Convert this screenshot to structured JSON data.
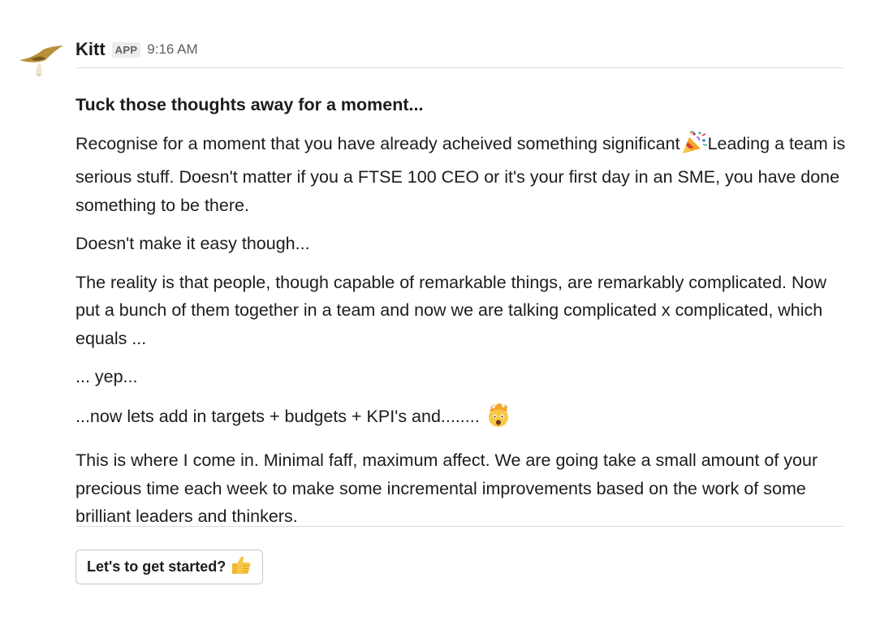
{
  "message": {
    "sender": "Kitt",
    "badge": "APP",
    "time": "9:16 AM",
    "heading": "Tuck those thoughts away for a moment...",
    "p1_before": "Recognise for a moment that you have already acheived something significant",
    "p1_emoji": "party-popper",
    "p1_after": "Leading a team is serious stuff. Doesn't matter if you a FTSE 100 CEO or it's your first day in an SME, you have done something to be there.",
    "p2": "Doesn't make it easy though...",
    "p3": "The reality is that people, though capable of remarkable things, are remarkably complicated. Now put a bunch of them together in a team and now we are talking complicated x complicated, which equals ...",
    "p4": "... yep...",
    "p5_text": "...now lets add in targets + budgets + KPI's and........",
    "p5_emoji": "exploding-head",
    "p6": "This is where I come in. Minimal faff, maximum affect. We are going take a small amount of your precious time each week to make some incremental improvements based on the work of some brilliant leaders and thinkers."
  },
  "button": {
    "label": "Let's to get started?",
    "emoji": "thumbs-up"
  }
}
